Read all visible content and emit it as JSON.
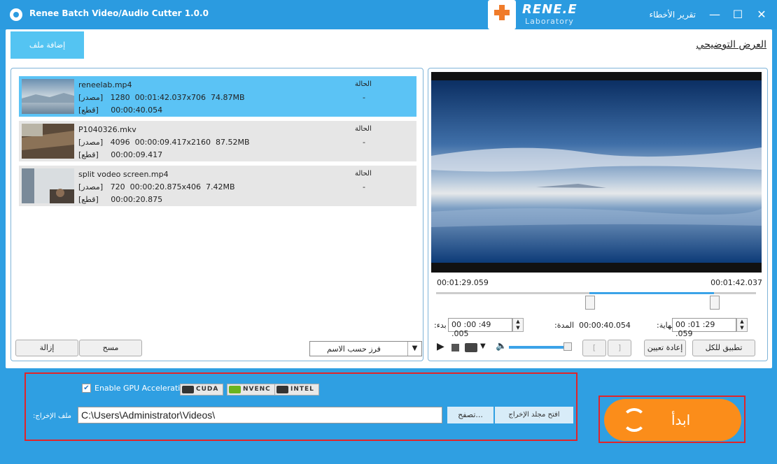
{
  "titlebar": {
    "title": "Renee Batch Video/Audio Cutter 1.0.0",
    "logo_name": "RENE.E",
    "logo_sub": "Laboratory",
    "report": "تقرير الأخطاء",
    "minimize": "—",
    "maximize": "☐",
    "close": "✕"
  },
  "toolbar": {
    "add_file": "إضافة ملف",
    "preview": "العرض التوضيحي"
  },
  "files": [
    {
      "name": "reneelab.mp4",
      "source_label": "[مصدر]",
      "source_duration": "00:01:42.037",
      "resolution": "1280x706",
      "size": "74.87MB",
      "cut_label": "[قطع]",
      "cut_duration": "00:00:40.054",
      "status_header": "الحالة",
      "status": "-"
    },
    {
      "name": "P1040326.mkv",
      "source_label": "[مصدر]",
      "source_duration": "00:00:09.417",
      "resolution": "4096x2160",
      "size": "87.52MB",
      "cut_label": "[قطع]",
      "cut_duration": "00:00:09.417",
      "status_header": "الحالة",
      "status": "-"
    },
    {
      "name": "split vodeo screen.mp4",
      "source_label": "[مصدر]",
      "source_duration": "00:00:20.875",
      "resolution": "720x406",
      "size": "7.42MB",
      "cut_label": "[قطع]",
      "cut_duration": "00:00:20.875",
      "status_header": "الحالة",
      "status": "-"
    }
  ],
  "list_controls": {
    "remove": "إزالة",
    "clear": "مسح",
    "sort": "فرز حسب الاسم"
  },
  "player": {
    "time_current": "00:01:29.059",
    "time_total": "00:01:42.037",
    "start_label": "بدء:",
    "start_value": "00 :00 :49 .005",
    "duration_label": "المدة:",
    "duration_value": "00:00:40.054",
    "end_label": "نهاية:",
    "end_value": "00 :01 :29 .059",
    "reset": "إعادة تعيين",
    "apply_all": "تطبيق للكل",
    "mark_in": "[",
    "mark_out": "]",
    "volume": 0.95
  },
  "output": {
    "gpu_label": "Enable GPU Acceleration",
    "gpu_checked": true,
    "badges": [
      "CUDA",
      "NVENC",
      "INTEL"
    ],
    "folder_label": "ملف الإخراج:",
    "folder_path": "C:\\Users\\Administrator\\Videos\\",
    "browse": "تصفح...",
    "open_folder": "افتح مجلد الإخراج"
  },
  "start": {
    "label": "ابدأ"
  }
}
